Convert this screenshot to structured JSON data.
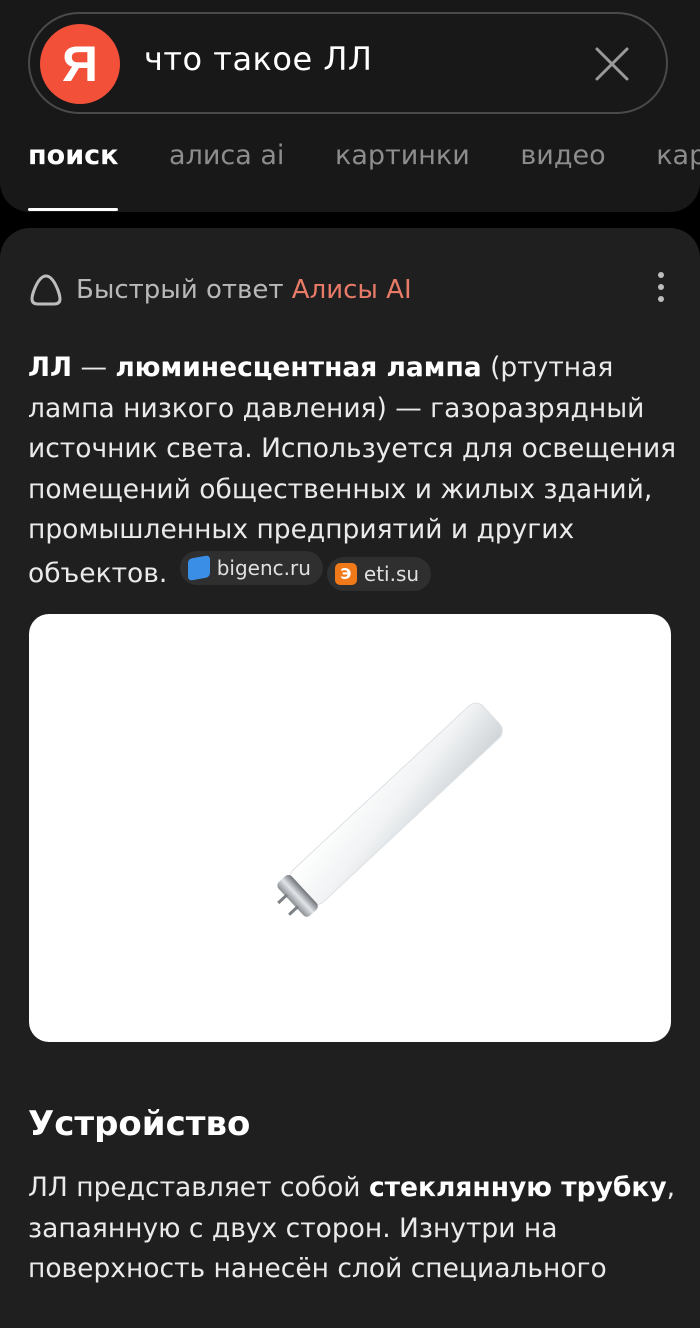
{
  "search": {
    "logo_letter": "Я",
    "query": "что такое ЛЛ"
  },
  "tabs": [
    {
      "label": "поиск",
      "active": true
    },
    {
      "label": "алиса ai",
      "active": false
    },
    {
      "label": "картинки",
      "active": false
    },
    {
      "label": "видео",
      "active": false
    },
    {
      "label": "карты",
      "active": false
    }
  ],
  "answer_card": {
    "header_prefix": "Быстрый ответ",
    "header_brand": "Алисы AI",
    "term": "ЛЛ",
    "dash": " — ",
    "definition_bold": "люминесцентная лампа",
    "definition_rest": " (ртутная лампа низкого давления) — газоразрядный источник света. Используется для освещения помещений общественных и жилых зданий, промышленных предприятий и других объектов.",
    "sources": [
      {
        "label": "bigenc.ru",
        "icon": "bigenc-icon"
      },
      {
        "label": "eti.su",
        "icon": "eti-icon"
      }
    ],
    "image_alt": "fluorescent-tube-lamp-image"
  },
  "section": {
    "title": "Устройство",
    "text_start": "ЛЛ представляет собой ",
    "text_bold": "стеклянную трубку",
    "text_end": ", запаянную с двух сторон. Изнутри на поверхность нанесён слой специального"
  },
  "colors": {
    "logo": "#f3503a",
    "brand_text": "#e87a68",
    "background": "#000000",
    "card": "#1f1f1f"
  }
}
